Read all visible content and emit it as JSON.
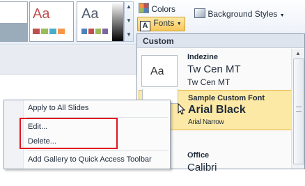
{
  "ribbon": {
    "colors_label": "Colors",
    "fonts_label": "Fonts",
    "background_styles_label": "Background Styles",
    "theme_thumbnails": [
      {
        "sample": ""
      },
      {
        "sample": "Aa",
        "color": "#c0504d"
      },
      {
        "sample": "Aa",
        "color": "#4f5b6b"
      }
    ]
  },
  "fonts_menu": {
    "header": "Custom",
    "items": [
      {
        "name": "Indezine",
        "heading_font": "Tw Cen MT",
        "body_font": "Tw Cen MT",
        "preview": "Aa",
        "selected": false
      },
      {
        "name": "Sample Custom Font",
        "heading_font": "Arial Black",
        "body_font": "Arial Narrow",
        "preview": "",
        "selected": true
      },
      {
        "name": "Office",
        "heading_font": "Calibri",
        "body_font": "",
        "preview": "",
        "selected": false
      }
    ]
  },
  "context_menu": {
    "items": [
      {
        "label": "Apply to All Slides"
      },
      {
        "label": "Edit..."
      },
      {
        "label": "Delete..."
      },
      {
        "label": "Add Gallery to Quick Access Toolbar"
      }
    ]
  },
  "colors": {
    "highlight_border": "#e0141e",
    "selected_item_bg": "#fde9a6",
    "fonts_button_bg": "#f7c75a"
  }
}
